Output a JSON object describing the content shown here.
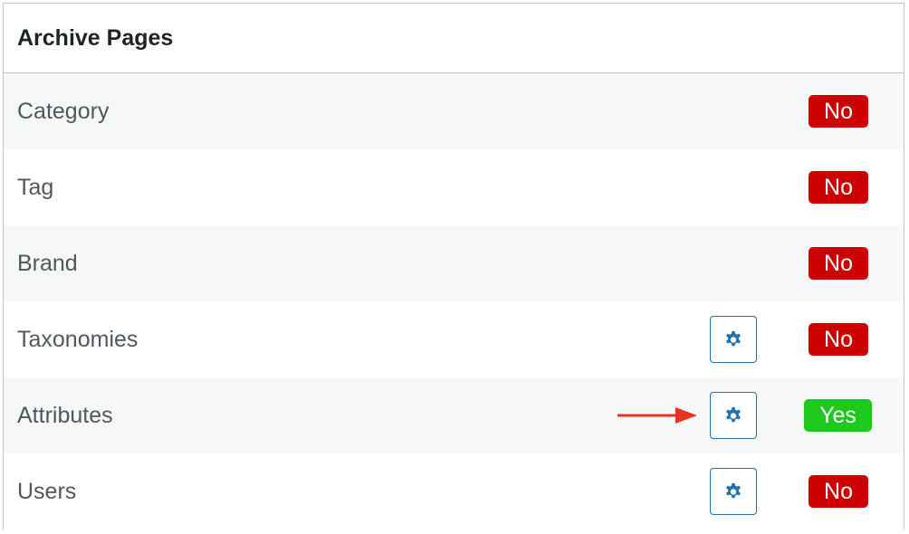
{
  "panel": {
    "title": "Archive Pages"
  },
  "rows": [
    {
      "label": "Category",
      "status": "No",
      "has_settings": false
    },
    {
      "label": "Tag",
      "status": "No",
      "has_settings": false
    },
    {
      "label": "Brand",
      "status": "No",
      "has_settings": false
    },
    {
      "label": "Taxonomies",
      "status": "No",
      "has_settings": true
    },
    {
      "label": "Attributes",
      "status": "Yes",
      "has_settings": true,
      "highlighted": true
    },
    {
      "label": "Users",
      "status": "No",
      "has_settings": true
    }
  ],
  "icons": {
    "settings": "gear-icon",
    "pointer": "arrow-right-icon"
  },
  "colors": {
    "status_no": "#cc0000",
    "status_yes": "#1ec91e",
    "settings_accent": "#2271b1",
    "annotation_arrow": "#e8341c"
  }
}
